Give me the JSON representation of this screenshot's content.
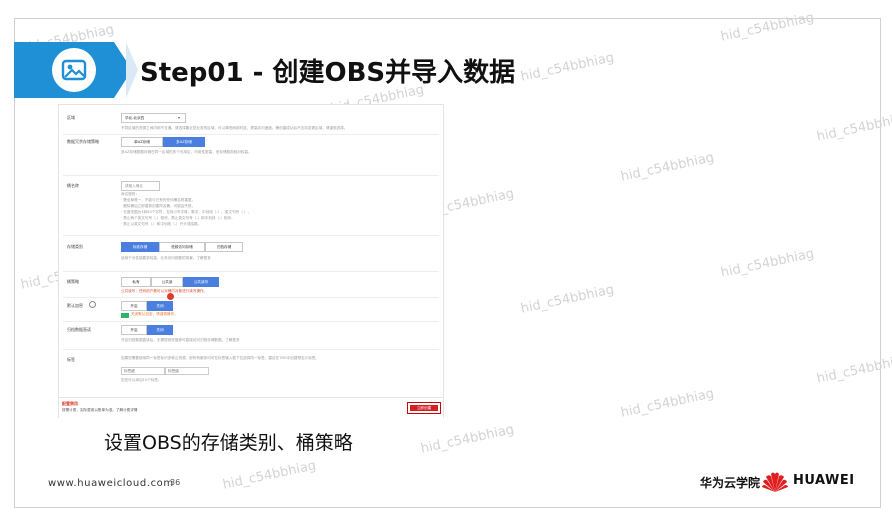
{
  "slide": {
    "title": "Step01 - 创建OBS并导入数据",
    "caption": "设置OBS的存储类别、桶策略",
    "website": "www.huaweicloud.com",
    "page_number": "36",
    "brand_cn": "华为云学院",
    "brand_en": "HUAWEI",
    "watermark": "hid_c54bbhiag"
  },
  "screenshot": {
    "region_label": "区域",
    "region_value": "华北-北京四",
    "region_hint": "不同区域的资源之间内网不互通。请选择靠近您业务的区域，可以降低网络时延、提高访问速度。桶创建成功后不支持变更区域，请谨慎选择。",
    "copy_label": "数据冗余存储策略",
    "copy_options": [
      "单AZ存储",
      "多AZ存储"
    ],
    "copy_hint": "多AZ存储数据存储在同一区域的多个可用区，可用性更高，但存储费用相对较高。",
    "name_label": "桶名称",
    "name_value": "请输入桶名",
    "name_hint": [
      "命名规则：",
      "· 需全局唯一，不能与已有的任何桶名称重复。",
      "· 删除桶后立即重新创建同名桶，可能会失败。",
      "· 长度范围为3到63个字符，支持小写字母、数字、中划线（-）、英文句号（.）。",
      "· 禁止两个英文句号（.）相邻，禁止英文句号（.）和中划线（-）相邻。",
      "· 禁止以英文句号（.）和中划线（-）开头或结尾。"
    ],
    "class_label": "存储类别",
    "class_options": [
      "标准存储",
      "低频访问存储",
      "归档存储"
    ],
    "class_hint": "适用于对性能要求较高，业务访问频繁的场景。了解更多",
    "policy_label": "桶策略",
    "policy_options": [
      "私有",
      "公共读",
      "公共读写"
    ],
    "policy_warn": "公共读写：任何用户都可以对桶内对象进行读写操作。",
    "encrypt_label": "默认加密",
    "encrypt_options": [
      "开启",
      "关闭"
    ],
    "encrypt_note": "关闭默认加密，请谨慎操作。",
    "log_label": "归档数据直读",
    "log_options": [
      "开启",
      "关闭"
    ],
    "log_hint": "开启归档数据直读后，无需提前恢复即可直接访问归档存储数据。了解更多",
    "tag_label": "标签",
    "tag_hint": "如果您需要使用同一标签标识多种云资源，即所有服务均可在标签输入框下拉选择同一标签，建议在TMS中创建预定义标签。",
    "tag_key_placeholder": "标签键",
    "tag_value_placeholder": "标签值",
    "tag_count": "您还可以添加10个标签。",
    "fee_label": "配置费用",
    "fee_hint": "按需计费，实际费用以账单为准。了解计费详情",
    "create_button": "立即创建"
  }
}
